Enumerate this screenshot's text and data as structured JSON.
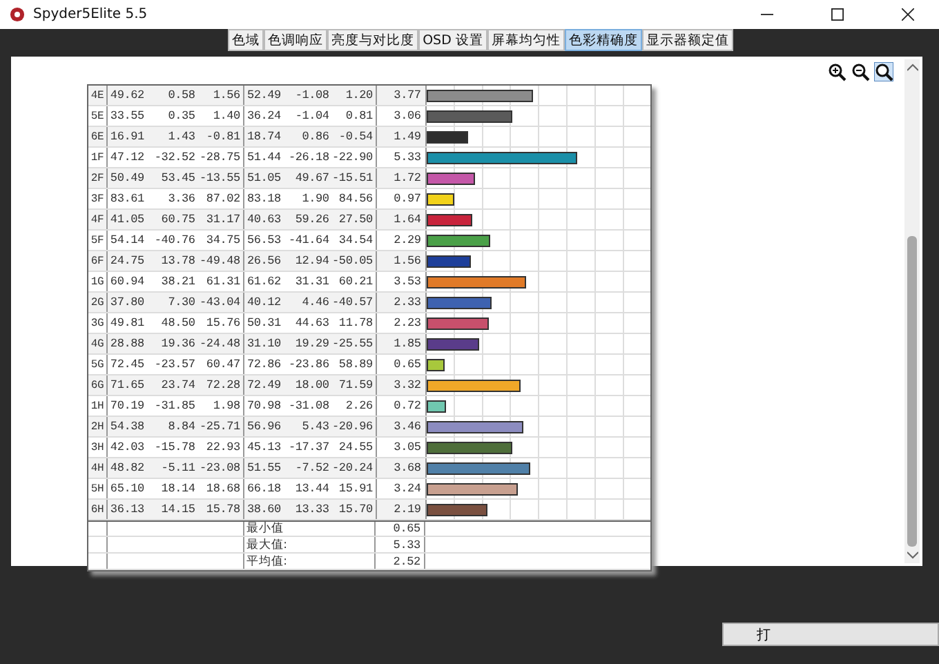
{
  "window": {
    "title": "Spyder5Elite 5.5"
  },
  "tabs": [
    {
      "label": "色域",
      "selected": false
    },
    {
      "label": "色调响应",
      "selected": false
    },
    {
      "label": "亮度与对比度",
      "selected": false
    },
    {
      "label": "OSD 设置",
      "selected": false
    },
    {
      "label": "屏幕均匀性",
      "selected": false
    },
    {
      "label": "色彩精确度",
      "selected": true
    },
    {
      "label": "显示器额定值",
      "selected": false
    }
  ],
  "zoom_tools": [
    {
      "kind": "zoom-in",
      "selected": false
    },
    {
      "kind": "zoom-out",
      "selected": false
    },
    {
      "kind": "zoom-fit",
      "selected": true
    }
  ],
  "table": {
    "rows": [
      {
        "patch": "4E",
        "values": [
          "49.62",
          "0.58",
          "1.56",
          "52.49",
          "-1.08",
          "1.20"
        ],
        "delta_e": "3.77",
        "color": "#8c8c8c"
      },
      {
        "patch": "5E",
        "values": [
          "33.55",
          "0.35",
          "1.40",
          "36.24",
          "-1.04",
          "0.81"
        ],
        "delta_e": "3.06",
        "color": "#5a5a5a"
      },
      {
        "patch": "6E",
        "values": [
          "16.91",
          "1.43",
          "-0.81",
          "18.74",
          "0.86",
          "-0.54"
        ],
        "delta_e": "1.49",
        "color": "#2e2e2e"
      },
      {
        "patch": "1F",
        "values": [
          "47.12",
          "-32.52",
          "-28.75",
          "51.44",
          "-26.18",
          "-22.90"
        ],
        "delta_e": "5.33",
        "color": "#1a8fa8"
      },
      {
        "patch": "2F",
        "values": [
          "50.49",
          "53.45",
          "-13.55",
          "51.05",
          "49.67",
          "-15.51"
        ],
        "delta_e": "1.72",
        "color": "#c457a8"
      },
      {
        "patch": "3F",
        "values": [
          "83.61",
          "3.36",
          "87.02",
          "83.18",
          "1.90",
          "84.56"
        ],
        "delta_e": "0.97",
        "color": "#f2d21a"
      },
      {
        "patch": "4F",
        "values": [
          "41.05",
          "60.75",
          "31.17",
          "40.63",
          "59.26",
          "27.50"
        ],
        "delta_e": "1.64",
        "color": "#c8243c"
      },
      {
        "patch": "5F",
        "values": [
          "54.14",
          "-40.76",
          "34.75",
          "56.53",
          "-41.64",
          "34.54"
        ],
        "delta_e": "2.29",
        "color": "#4aa048"
      },
      {
        "patch": "6F",
        "values": [
          "24.75",
          "13.78",
          "-49.48",
          "26.56",
          "12.94",
          "-50.05"
        ],
        "delta_e": "1.56",
        "color": "#1e3f9a"
      },
      {
        "patch": "1G",
        "values": [
          "60.94",
          "38.21",
          "61.31",
          "61.62",
          "31.31",
          "60.21"
        ],
        "delta_e": "3.53",
        "color": "#e07a28"
      },
      {
        "patch": "2G",
        "values": [
          "37.80",
          "7.30",
          "-43.04",
          "40.12",
          "4.46",
          "-40.57"
        ],
        "delta_e": "2.33",
        "color": "#3e62b0"
      },
      {
        "patch": "3G",
        "values": [
          "49.81",
          "48.50",
          "15.76",
          "50.31",
          "44.63",
          "11.78"
        ],
        "delta_e": "2.23",
        "color": "#c8506c"
      },
      {
        "patch": "4G",
        "values": [
          "28.88",
          "19.36",
          "-24.48",
          "31.10",
          "19.29",
          "-25.55"
        ],
        "delta_e": "1.85",
        "color": "#5a3c8a"
      },
      {
        "patch": "5G",
        "values": [
          "72.45",
          "-23.57",
          "60.47",
          "72.86",
          "-23.86",
          "58.89"
        ],
        "delta_e": "0.65",
        "color": "#a8c83c"
      },
      {
        "patch": "6G",
        "values": [
          "71.65",
          "23.74",
          "72.28",
          "72.49",
          "18.00",
          "71.59"
        ],
        "delta_e": "3.32",
        "color": "#f0a828"
      },
      {
        "patch": "1H",
        "values": [
          "70.19",
          "-31.85",
          "1.98",
          "70.98",
          "-31.08",
          "2.26"
        ],
        "delta_e": "0.72",
        "color": "#70c8b0"
      },
      {
        "patch": "2H",
        "values": [
          "54.38",
          "8.84",
          "-25.71",
          "56.96",
          "5.43",
          "-20.96"
        ],
        "delta_e": "3.46",
        "color": "#8c8cc0"
      },
      {
        "patch": "3H",
        "values": [
          "42.03",
          "-15.78",
          "22.93",
          "45.13",
          "-17.37",
          "24.55"
        ],
        "delta_e": "3.05",
        "color": "#4e6e3a"
      },
      {
        "patch": "4H",
        "values": [
          "48.82",
          "-5.11",
          "-23.08",
          "51.55",
          "-7.52",
          "-20.24"
        ],
        "delta_e": "3.68",
        "color": "#5080a8"
      },
      {
        "patch": "5H",
        "values": [
          "65.10",
          "18.14",
          "18.68",
          "66.18",
          "13.44",
          "15.91"
        ],
        "delta_e": "3.24",
        "color": "#c8a090"
      },
      {
        "patch": "6H",
        "values": [
          "36.13",
          "14.15",
          "15.78",
          "38.60",
          "13.33",
          "15.70"
        ],
        "delta_e": "2.19",
        "color": "#7a5040"
      }
    ],
    "summary": [
      {
        "label": "最小值",
        "value": "0.65"
      },
      {
        "label": "最大值:",
        "value": "5.33"
      },
      {
        "label": "平均值:",
        "value": "2.52"
      }
    ]
  },
  "button": {
    "label": "打"
  }
}
